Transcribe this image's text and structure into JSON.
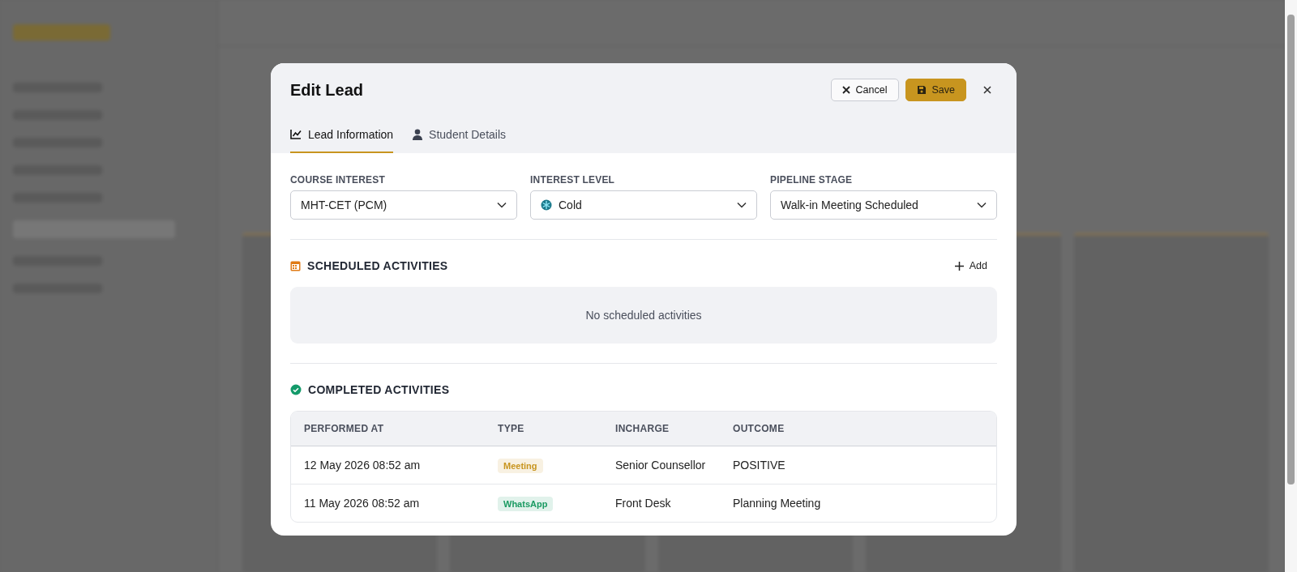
{
  "modal": {
    "title": "Edit Lead",
    "buttons": [
      {
        "label": "Cancel",
        "kind": "cancel"
      },
      {
        "label": "Save",
        "kind": "save"
      }
    ],
    "tabs": [
      {
        "label": "Lead Information",
        "selected": true,
        "kind": "chart"
      },
      {
        "label": "Student Details",
        "selected": false,
        "kind": "person"
      }
    ],
    "fields": [
      {
        "label": "COURSE INTEREST",
        "value": "MHT-CET (PCM)",
        "kind": "plain"
      },
      {
        "label": "INTEREST LEVEL",
        "value": "Cold",
        "kind": "snowflake"
      },
      {
        "label": "PIPELINE STAGE",
        "value": "Walk-in Meeting Scheduled",
        "kind": "plain"
      }
    ],
    "scheduled": {
      "title": "SCHEDULED ACTIVITIES",
      "add_label": "Add",
      "empty_text": "No scheduled activities"
    },
    "completed": {
      "title": "COMPLETED ACTIVITIES",
      "columns": [
        "PERFORMED AT",
        "TYPE",
        "INCHARGE",
        "OUTCOME"
      ],
      "rows": [
        {
          "performed_at": "12 May 2026 08:52 am",
          "type": {
            "label": "Meeting",
            "color": "#c8951f"
          },
          "incharge": "Senior Counsellor",
          "outcome": "POSITIVE"
        },
        {
          "performed_at": "11 May 2026 08:52 am",
          "type": {
            "label": "WhatsApp",
            "color": "#1a9a62"
          },
          "incharge": "Front Desk",
          "outcome": "Planning Meeting"
        }
      ]
    }
  }
}
